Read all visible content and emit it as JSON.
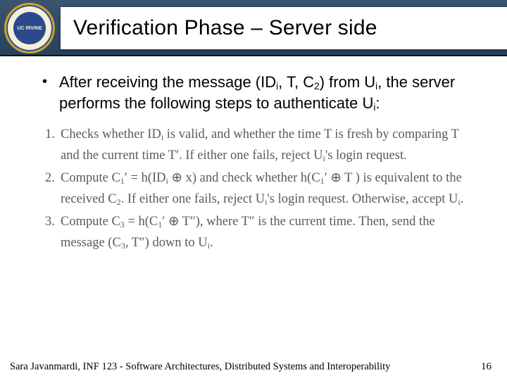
{
  "header": {
    "seal_text": "UC IRVINE",
    "title": "Verification Phase – Server side"
  },
  "bullet": {
    "pre": "After receiving the message (ID",
    "sub1": "i",
    "mid1": ", T, C",
    "sub2": "2",
    "mid2": ") from U",
    "sub3": "i",
    "mid3": ", the server performs the following steps to authenticate U",
    "sub4": "i",
    "post": ":"
  },
  "steps": {
    "s1": {
      "num": "1.",
      "a": "Checks whether ID",
      "a_sub": "i",
      "b": " is valid, and whether the time T is fresh by comparing T and the current time T′. If either one fails, reject U",
      "b_sub": "i",
      "c": "'s login request."
    },
    "s2": {
      "num": "2.",
      "a": "Compute C",
      "a_sub": "1",
      "b": "′ = h(ID",
      "b_sub": "i",
      "c": " ⊕ x) and check whether h(C",
      "c_sub": "1",
      "d": "′ ⊕ T ) is equivalent to the received C",
      "d_sub": "2",
      "e": ". If either one fails, reject U",
      "e_sub": "i",
      "f": "'s login request. Otherwise, accept U",
      "f_sub": "i",
      "g": "."
    },
    "s3": {
      "num": "3.",
      "a": "Compute C",
      "a_sub": "3",
      "b": " = h(C",
      "b_sub": "1",
      "c": "′ ⊕ T″), where T″ is the current time. Then, send the message (C",
      "c_sub": "3",
      "d": ", T″) down to U",
      "d_sub": "i",
      "e": "."
    }
  },
  "footer": {
    "left": "Sara Javanmardi, INF 123 - Software Architectures, Distributed Systems and Interoperability",
    "page": "16"
  }
}
